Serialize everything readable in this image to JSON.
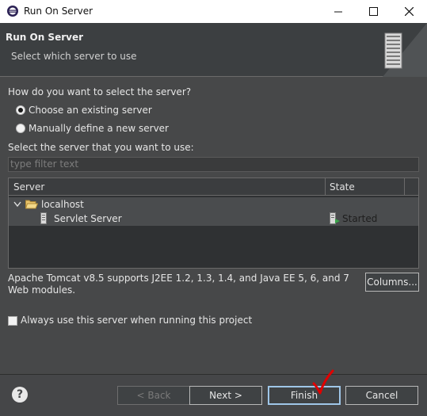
{
  "window": {
    "title": "Run On Server",
    "controls": {
      "minimize": "minimize-icon",
      "maximize": "maximize-icon",
      "close": "close-icon"
    }
  },
  "header": {
    "title": "Run On Server",
    "subtitle": "Select which server to use"
  },
  "selection": {
    "question": "How do you want to select the server?",
    "options": [
      {
        "label": "Choose an existing server",
        "checked": true
      },
      {
        "label": "Manually define a new server",
        "checked": false
      }
    ],
    "list_label": "Select the server that you want to use:",
    "filter_placeholder": "type filter text"
  },
  "server_table": {
    "columns": [
      "Server",
      "State"
    ],
    "rows": [
      {
        "name": "localhost",
        "state": "",
        "type": "folder",
        "expanded": true
      },
      {
        "name": "Servlet Server",
        "state": "Started",
        "type": "server"
      }
    ]
  },
  "description": "Apache Tomcat v8.5 supports J2EE 1.2, 1.3, 1.4, and Java EE 5, 6, and 7 Web modules.",
  "columns_button": "Columns...",
  "always_use": {
    "label": "Always use this server when running this project",
    "checked": false
  },
  "buttons": {
    "back": "< Back",
    "next": "Next >",
    "finish": "Finish",
    "cancel": "Cancel"
  },
  "help_icon": "?",
  "colors": {
    "background": "#474849",
    "header": "#3c3f41",
    "accent_check": "#e00000",
    "focus": "#9fc6e8"
  }
}
